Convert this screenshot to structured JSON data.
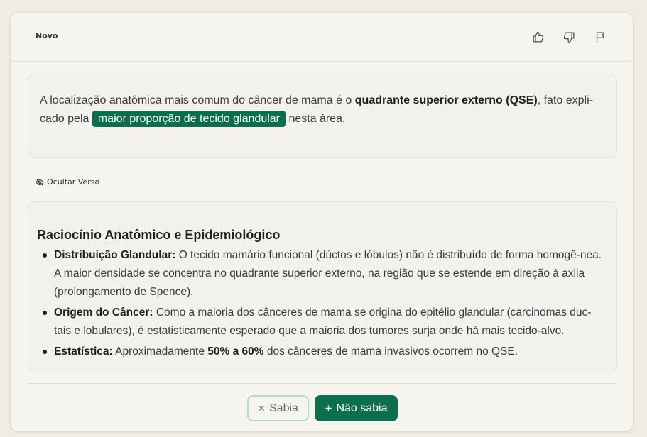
{
  "header": {
    "label": "Novo",
    "icons": [
      "thumbs-up-icon",
      "thumbs-down-icon",
      "flag-icon"
    ]
  },
  "front": {
    "part1": "A localização anatômica mais comum do câncer de mama é o ",
    "bold": "quadrante superior externo (QSE)",
    "part2": ", fato expli-cado pela ",
    "highlight": "maior proporção de tecido glandular",
    "part3": " nesta área."
  },
  "toggle": {
    "label": "Ocultar Verso",
    "icon": "eye-off-icon"
  },
  "back": {
    "title": "Raciocínio Anatômico e Epidemiológico",
    "items": [
      {
        "term": "Distribuição Glandular:",
        "text": " O tecido mamário funcional (dúctos e lóbulos) não é distribuído de forma homogê-nea. A maior densidade se concentra no quadrante superior externo, na região que se estende em direção à axila (prolongamento de Spence)."
      },
      {
        "term": "Origem do Câncer:",
        "text": " Como a maioria dos cânceres de mama se origina do epitélio glandular (carcinomas duc-tais e lobulares), é estatisticamente esperado que a maioria dos tumores surja onde há mais tecido-alvo."
      },
      {
        "term": "Estatística:",
        "text_before": " Aproximadamente ",
        "bold": "50% a 60%",
        "text_after": " dos cânceres de mama invasivos ocorrem no QSE."
      }
    ]
  },
  "actions": {
    "knew_glyph": "×",
    "knew_label": "Sabia",
    "didnt_glyph": "+",
    "didnt_label": "Não sabia"
  },
  "colors": {
    "accent": "#0a6e4f",
    "background": "#f0ece2",
    "card": "#f6f4ef"
  }
}
